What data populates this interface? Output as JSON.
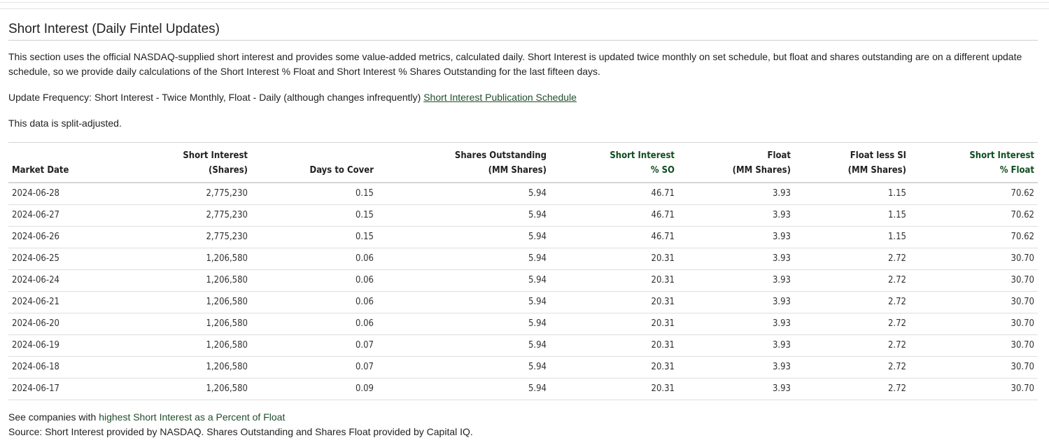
{
  "section": {
    "title": "Short Interest (Daily Fintel Updates)",
    "description": "This section uses the official NASDAQ-supplied short interest and provides some value-added metrics, calculated daily. Short Interest is updated twice monthly on set schedule, but float and shares outstanding are on a different update schedule, so we provide daily calculations of the Short Interest % Float and Short Interest % Shares Outstanding for the last fifteen days.",
    "update_frequency_text": "Update Frequency: Short Interest - Twice Monthly, Float - Daily (although changes infrequently) ",
    "schedule_link": "Short Interest Publication Schedule",
    "split_note": "This data is split-adjusted."
  },
  "table": {
    "headers": [
      {
        "line1": "",
        "line2": "Market Date"
      },
      {
        "line1": "Short Interest",
        "line2": "(Shares)"
      },
      {
        "line1": "",
        "line2": "Days to Cover"
      },
      {
        "line1": "Shares Outstanding",
        "line2": "(MM Shares)"
      },
      {
        "line1": "Short Interest",
        "line2": "% SO"
      },
      {
        "line1": "Float",
        "line2": "(MM Shares)"
      },
      {
        "line1": "Float less SI",
        "line2": "(MM Shares)"
      },
      {
        "line1": "Short Interest",
        "line2": "% Float"
      }
    ],
    "rows": [
      [
        "2024-06-28",
        "2,775,230",
        "0.15",
        "5.94",
        "46.71",
        "3.93",
        "1.15",
        "70.62"
      ],
      [
        "2024-06-27",
        "2,775,230",
        "0.15",
        "5.94",
        "46.71",
        "3.93",
        "1.15",
        "70.62"
      ],
      [
        "2024-06-26",
        "2,775,230",
        "0.15",
        "5.94",
        "46.71",
        "3.93",
        "1.15",
        "70.62"
      ],
      [
        "2024-06-25",
        "1,206,580",
        "0.06",
        "5.94",
        "20.31",
        "3.93",
        "2.72",
        "30.70"
      ],
      [
        "2024-06-24",
        "1,206,580",
        "0.06",
        "5.94",
        "20.31",
        "3.93",
        "2.72",
        "30.70"
      ],
      [
        "2024-06-21",
        "1,206,580",
        "0.06",
        "5.94",
        "20.31",
        "3.93",
        "2.72",
        "30.70"
      ],
      [
        "2024-06-20",
        "1,206,580",
        "0.06",
        "5.94",
        "20.31",
        "3.93",
        "2.72",
        "30.70"
      ],
      [
        "2024-06-19",
        "1,206,580",
        "0.07",
        "5.94",
        "20.31",
        "3.93",
        "2.72",
        "30.70"
      ],
      [
        "2024-06-18",
        "1,206,580",
        "0.07",
        "5.94",
        "20.31",
        "3.93",
        "2.72",
        "30.70"
      ],
      [
        "2024-06-17",
        "1,206,580",
        "0.09",
        "5.94",
        "20.31",
        "3.93",
        "2.72",
        "30.70"
      ]
    ]
  },
  "footer": {
    "see_prefix": "See companies with ",
    "see_link": "highest Short Interest as a Percent of Float",
    "source": "Source: Short Interest provided by NASDAQ. Shares Outstanding and Shares Float provided by Capital IQ."
  },
  "colors": {
    "accent_green": "#0f4d1f",
    "link_green": "#1f4d2b"
  }
}
